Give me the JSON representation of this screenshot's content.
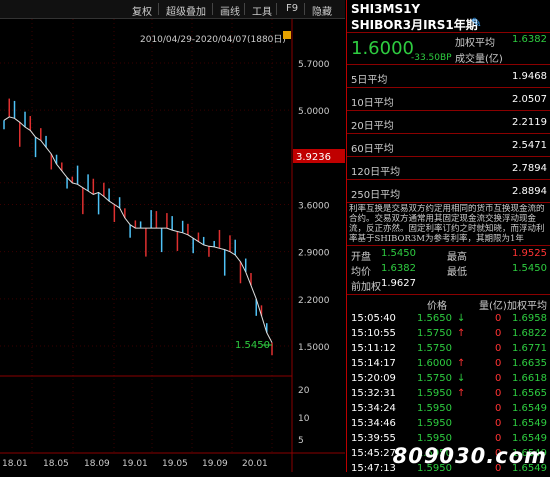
{
  "toolbar": {
    "items": [
      "复权",
      "超级叠加",
      "画线",
      "工具",
      "F9",
      "隐藏"
    ]
  },
  "chart_header": {
    "date_range": "2010/04/29-2020/04/07(1880日)"
  },
  "chart_data": {
    "type": "line",
    "y_ticks": [
      "5.7000",
      "5.0000",
      "3.9236",
      "3.6000",
      "2.9000",
      "2.2000",
      "1.5000",
      "20",
      "10",
      "5"
    ],
    "x_ticks": [
      "18.01",
      "18.05",
      "18.09",
      "19.01",
      "19.05",
      "19.09",
      "20.01"
    ],
    "current_price": "3.9236",
    "last_marker": "1.5450",
    "ylim": [
      1.5,
      5.7
    ],
    "series": [
      {
        "values": [
          4.85,
          4.9,
          4.88,
          4.82,
          4.75,
          4.7,
          4.6,
          4.55,
          4.45,
          4.35,
          4.2,
          4.1,
          4.0,
          3.92,
          3.9,
          3.85,
          3.8,
          3.75,
          3.78,
          3.72,
          3.65,
          3.6,
          3.55,
          3.4,
          3.3,
          3.25,
          3.25,
          3.25,
          3.25,
          3.25,
          3.25,
          3.25,
          3.22,
          3.2,
          3.18,
          3.15,
          3.1,
          3.05,
          3.0,
          2.98,
          2.97,
          2.95,
          2.93,
          2.9,
          2.85,
          2.75,
          2.6,
          2.4,
          2.2,
          1.95,
          1.7,
          1.55
        ]
      }
    ]
  },
  "panel": {
    "code": "SHI3MS1Y",
    "name": "SHIBOR3月IRS1年期",
    "price": "1.6000",
    "change": "-33.50BP",
    "wavg_label": "加权平均",
    "wavg_value": "1.6382",
    "volume_label": "成交量(亿)",
    "averages": [
      {
        "label": "5日平均",
        "value": "1.9468"
      },
      {
        "label": "10日平均",
        "value": "2.0507"
      },
      {
        "label": "20日平均",
        "value": "2.2119"
      },
      {
        "label": "60日平均",
        "value": "2.5471"
      },
      {
        "label": "120日平均",
        "value": "2.7894"
      },
      {
        "label": "250日平均",
        "value": "2.8894"
      }
    ],
    "description": "利率互换是交易双方约定用相同的货币互换现金流的合约。交易双方通常用其固定现金流交换浮动现金流，反正亦然。固定利率订约之时就知晓，而浮动利率基于SHIBOR3M为参考利率，其期限为1年",
    "stats": {
      "open_label": "开盘",
      "open_value": "1.5450",
      "high_label": "最高",
      "high_value": "1.9525",
      "avg_label": "均价",
      "avg_value": "1.6382",
      "low_label": "最低",
      "low_value": "1.5450",
      "prev_label": "前加权",
      "prev_value": "1.9627"
    },
    "trade_headers": {
      "price": "价格",
      "qty": "量(亿)",
      "wavg": "加权平均"
    },
    "trades": [
      {
        "time": "15:05:40",
        "price": "1.5650",
        "dir": "down",
        "qty": "0",
        "wavg": "1.6958"
      },
      {
        "time": "15:10:55",
        "price": "1.5750",
        "dir": "up",
        "qty": "0",
        "wavg": "1.6822"
      },
      {
        "time": "15:11:12",
        "price": "1.5750",
        "dir": "",
        "qty": "0",
        "wavg": "1.6771"
      },
      {
        "time": "15:14:17",
        "price": "1.6000",
        "dir": "up",
        "qty": "0",
        "wavg": "1.6635"
      },
      {
        "time": "15:20:09",
        "price": "1.5750",
        "dir": "down",
        "qty": "0",
        "wavg": "1.6618"
      },
      {
        "time": "15:32:31",
        "price": "1.5950",
        "dir": "up",
        "qty": "0",
        "wavg": "1.6565"
      },
      {
        "time": "15:34:24",
        "price": "1.5950",
        "dir": "",
        "qty": "0",
        "wavg": "1.6549"
      },
      {
        "time": "15:34:46",
        "price": "1.5950",
        "dir": "",
        "qty": "0",
        "wavg": "1.6549"
      },
      {
        "time": "15:39:55",
        "price": "1.5950",
        "dir": "",
        "qty": "0",
        "wavg": "1.6549"
      },
      {
        "time": "15:45:27",
        "price": "1.5950",
        "dir": "",
        "qty": "0",
        "wavg": "1.6549"
      },
      {
        "time": "15:47:13",
        "price": "1.5950",
        "dir": "",
        "qty": "0",
        "wavg": "1.6549"
      }
    ]
  },
  "watermark": "809030.com"
}
